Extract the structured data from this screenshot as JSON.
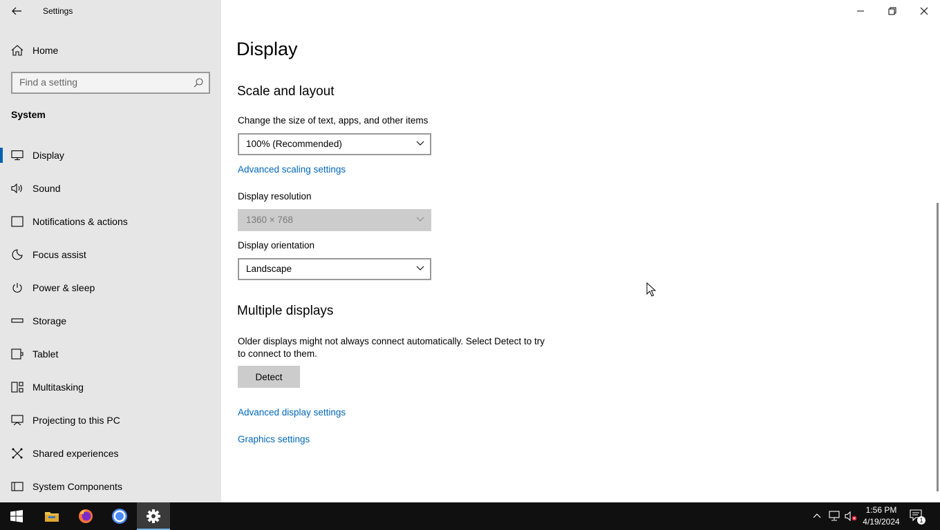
{
  "app": {
    "title": "Settings"
  },
  "sidebar": {
    "home_label": "Home",
    "search_placeholder": "Find a setting",
    "section_title": "System",
    "items": [
      {
        "label": "Display",
        "icon": "monitor-icon",
        "active": true
      },
      {
        "label": "Sound",
        "icon": "speaker-icon"
      },
      {
        "label": "Notifications & actions",
        "icon": "notification-icon"
      },
      {
        "label": "Focus assist",
        "icon": "moon-icon"
      },
      {
        "label": "Power & sleep",
        "icon": "power-icon"
      },
      {
        "label": "Storage",
        "icon": "storage-icon"
      },
      {
        "label": "Tablet",
        "icon": "tablet-icon"
      },
      {
        "label": "Multitasking",
        "icon": "multitasking-icon"
      },
      {
        "label": "Projecting to this PC",
        "icon": "projecting-icon"
      },
      {
        "label": "Shared experiences",
        "icon": "shared-icon"
      },
      {
        "label": "System Components",
        "icon": "components-icon"
      }
    ]
  },
  "main": {
    "page_title": "Display",
    "scale_section": {
      "title": "Scale and layout",
      "scale_label": "Change the size of text, apps, and other items",
      "scale_value": "100% (Recommended)",
      "advanced_scaling_link": "Advanced scaling settings",
      "resolution_label": "Display resolution",
      "resolution_value": "1360 × 768",
      "orientation_label": "Display orientation",
      "orientation_value": "Landscape"
    },
    "multiple_displays": {
      "title": "Multiple displays",
      "description": "Older displays might not always connect automatically. Select Detect to try to connect to them.",
      "detect_label": "Detect",
      "advanced_display_link": "Advanced display settings",
      "graphics_link": "Graphics settings"
    }
  },
  "taskbar": {
    "time": "1:56 PM",
    "date": "4/19/2024",
    "notification_count": "1",
    "apps": [
      "start-icon",
      "file-explorer-icon",
      "firefox-icon",
      "chrome-icon",
      "settings-icon"
    ]
  },
  "colors": {
    "accent": "#0063b1",
    "link": "#0067b8",
    "sidebar_bg": "#e6e6e6",
    "taskbar_bg": "#101010"
  }
}
